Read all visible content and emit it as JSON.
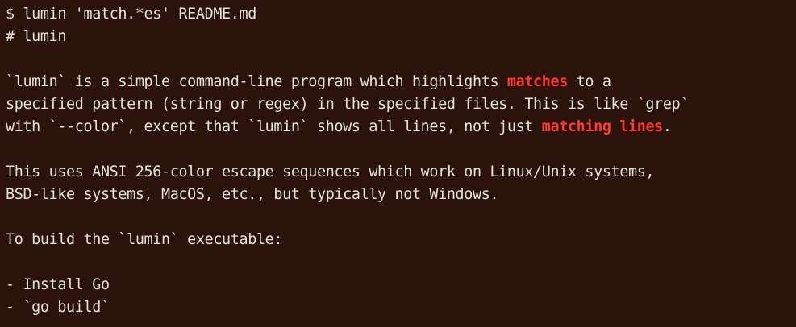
{
  "terminal": {
    "lines": [
      [
        {
          "text": "$ lumin 'match.*es' README.md",
          "highlight": false
        }
      ],
      [
        {
          "text": "# lumin",
          "highlight": false
        }
      ],
      [],
      [
        {
          "text": "`lumin` is a simple command-line program which highlights ",
          "highlight": false
        },
        {
          "text": "matches",
          "highlight": true
        },
        {
          "text": " to a",
          "highlight": false
        }
      ],
      [
        {
          "text": "specified pattern (string or regex) in the specified files. This is like `grep`",
          "highlight": false
        }
      ],
      [
        {
          "text": "with `--color`, except that `lumin` shows all lines, not just ",
          "highlight": false
        },
        {
          "text": "matching lines",
          "highlight": true
        },
        {
          "text": ".",
          "highlight": false
        }
      ],
      [],
      [
        {
          "text": "This uses ANSI 256-color escape sequences which work on Linux/Unix systems,",
          "highlight": false
        }
      ],
      [
        {
          "text": "BSD-like systems, MacOS, etc., but typically not Windows.",
          "highlight": false
        }
      ],
      [],
      [
        {
          "text": "To build the `lumin` executable:",
          "highlight": false
        }
      ],
      [],
      [
        {
          "text": "- Install Go",
          "highlight": false
        }
      ],
      [
        {
          "text": "- `go build`",
          "highlight": false
        }
      ]
    ]
  },
  "colors": {
    "background": "#2b120b",
    "text": "#e6e2dc",
    "highlight": "#ff3a2f"
  }
}
